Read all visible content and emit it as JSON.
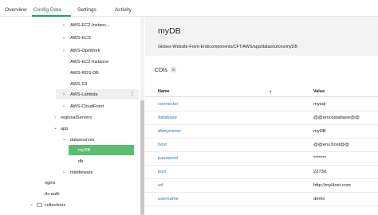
{
  "tabs": [
    {
      "label": "Overview"
    },
    {
      "label": "Config Data"
    },
    {
      "label": "Settings"
    },
    {
      "label": "Activity"
    }
  ],
  "tree": [
    {
      "label": "AWS-EC2-Instanc...",
      "chevron": "›"
    },
    {
      "label": "AWS-ECS",
      "chevron": "›"
    },
    {
      "label": "AWS-OpsWork",
      "chevron": "›"
    },
    {
      "label": "AWS-EC2-Instance",
      "chevron": ""
    },
    {
      "label": "AWS-RDS-DB",
      "chevron": ""
    },
    {
      "label": "AWS-S3",
      "chevron": ""
    },
    {
      "label": "AWS-Lambda",
      "chevron": "›",
      "more": "⋮"
    },
    {
      "label": "AWS-CloudFront",
      "chevron": "›"
    },
    {
      "label": "regionalServers",
      "chevron": "›"
    },
    {
      "label": "app",
      "chevron": "⌄"
    },
    {
      "label": "datasources",
      "chevron": "⌄"
    },
    {
      "label": "myDB",
      "chevron": ""
    },
    {
      "label": "db",
      "chevron": ""
    },
    {
      "label": "middleware",
      "chevron": "›"
    },
    {
      "label": "nginx",
      "chevron": ""
    },
    {
      "label": "dx-auth",
      "chevron": ""
    },
    {
      "label": "collections",
      "chevron": "⌄"
    }
  ],
  "main": {
    "title": "myDB",
    "path": "Globex-Website-Front-End/components/CFT/AWS/app/datasources/myDB",
    "section_label": "CDIs",
    "section_count": "8",
    "columns": {
      "name": "Name",
      "value": "Value",
      "sort_glyph": "▴"
    },
    "rows": [
      {
        "name": "connector",
        "value": "mysql"
      },
      {
        "name": "database",
        "value": "@@env.database@@"
      },
      {
        "name": "dbmyname",
        "value": "myDB"
      },
      {
        "name": "host",
        "value": "@@env.host@@"
      },
      {
        "name": "password",
        "value": "*******"
      },
      {
        "name": "port",
        "value": "22730"
      },
      {
        "name": "url",
        "value": "http://myHost.com"
      },
      {
        "name": "username",
        "value": "demo"
      }
    ]
  },
  "colors": {
    "accent": "#2a9d63",
    "selected": "#5bbd6e",
    "link": "#2a7ab8"
  }
}
